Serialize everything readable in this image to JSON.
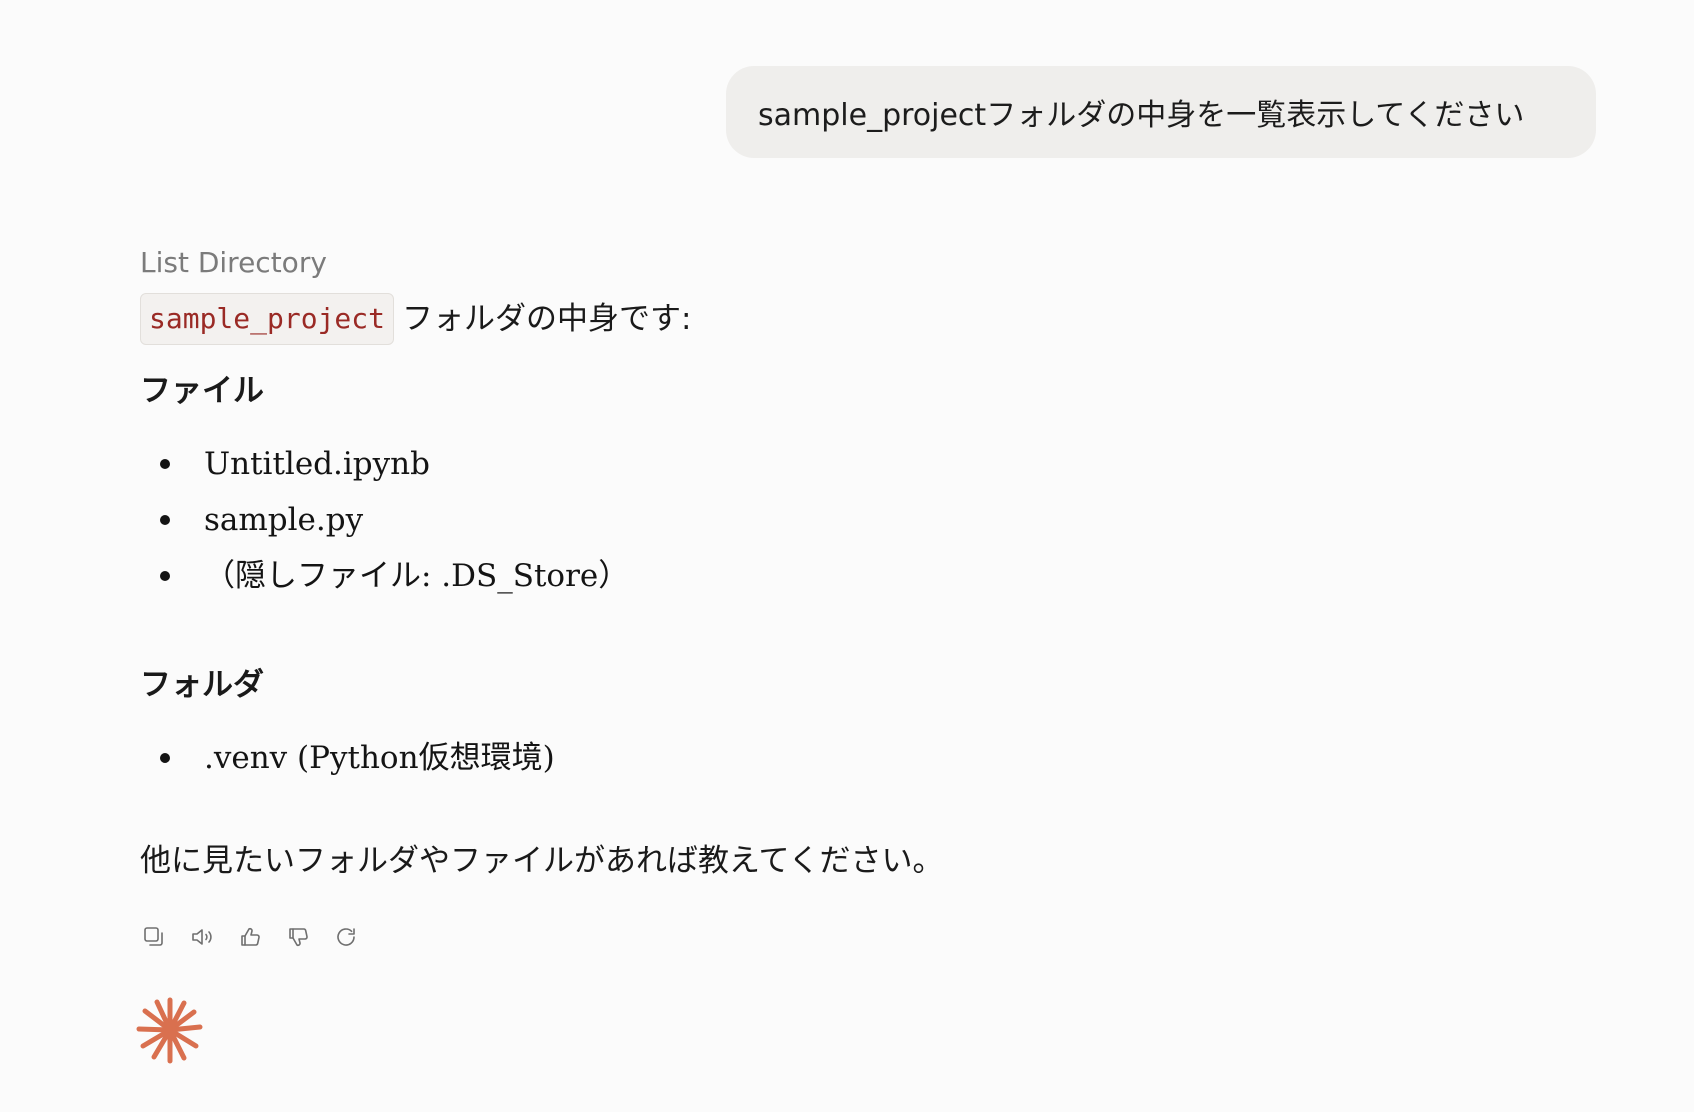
{
  "user_message": {
    "text": "sample_projectフォルダの中身を一覧表示してください"
  },
  "assistant": {
    "tool_label": "List Directory",
    "intro_code": "sample_project",
    "intro_text": "フォルダの中身です:",
    "files_heading": "ファイル",
    "files": [
      "Untitled.ipynb",
      "sample.py",
      "（隠しファイル: .DS_Store）"
    ],
    "folders_heading": "フォルダ",
    "folders": [
      ".venv (Python仮想環境)"
    ],
    "closing": "他に見たいフォルダやファイルがあれば教えてください。"
  },
  "actions": {
    "icons": [
      "copy-icon",
      "speaker-icon",
      "thumbs-up-icon",
      "thumbs-down-icon",
      "retry-icon"
    ]
  },
  "colors": {
    "background": "#fbfbfb",
    "user_bubble": "#efeeec",
    "inline_code_text": "#9a2a25",
    "spark": "#d9704f"
  }
}
